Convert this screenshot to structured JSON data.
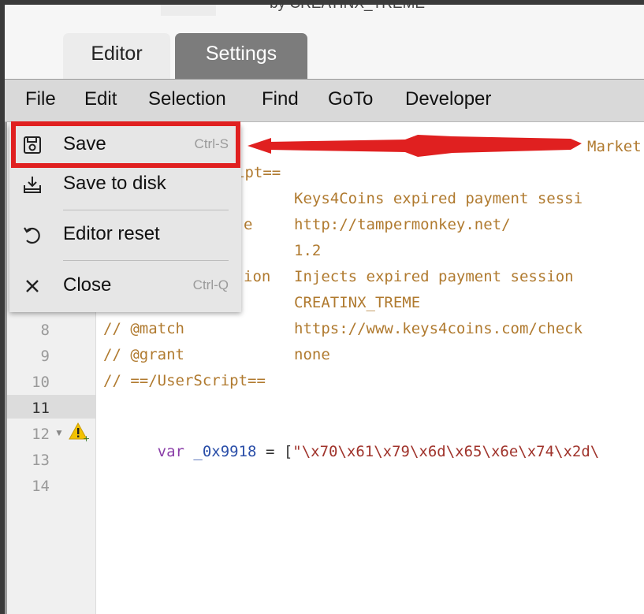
{
  "header": {
    "top_cut_text": "by CREATINX_TREME"
  },
  "tabs": [
    {
      "label": "Editor",
      "active": true
    },
    {
      "label": "Settings",
      "active": false
    }
  ],
  "menubar": [
    "File",
    "Edit",
    "Selection",
    "Find",
    "GoTo",
    "Developer"
  ],
  "file_menu": {
    "items": [
      {
        "label": "Save",
        "shortcut": "Ctrl-S",
        "icon": "floppy-disk-icon"
      },
      {
        "label": "Save to disk",
        "shortcut": "",
        "icon": "download-tray-icon"
      },
      {
        "label": "Editor reset",
        "shortcut": "",
        "icon": "undo-icon"
      },
      {
        "label": "Close",
        "shortcut": "Ctrl-Q",
        "icon": "close-icon"
      }
    ]
  },
  "editor": {
    "line_numbers": [
      "8",
      "9",
      "10",
      "11",
      "12",
      "13",
      "14"
    ],
    "active_line": "11",
    "visible_fragments": {
      "l1_tail": "Market",
      "l2_tail": "ipt==",
      "l3_value": "Keys4Coins expired payment sessi",
      "l4_key_tail": "e",
      "l4_value": "http://tampermonkey.net/",
      "l5_value": "1.2",
      "l6_key_tail": "ion",
      "l6_value": "Injects expired payment session",
      "l7_value": "CREATINX_TREME"
    },
    "lines": {
      "l8_key": "// @match",
      "l8_value": "https://www.keys4coins.com/check",
      "l9_key": "// @grant",
      "l9_value": "none",
      "l10": "// ==/UserScript==",
      "l12_kw": "var",
      "l12_name": "_0x9918",
      "l12_op": "= [",
      "l12_str": "\"\\x70\\x61\\x79\\x6d\\x65\\x6e\\x74\\x2d\\"
    }
  },
  "colors": {
    "highlight_box": "#e02020",
    "tab_active": "#ececec",
    "tab_inactive": "#7c7c7c"
  }
}
